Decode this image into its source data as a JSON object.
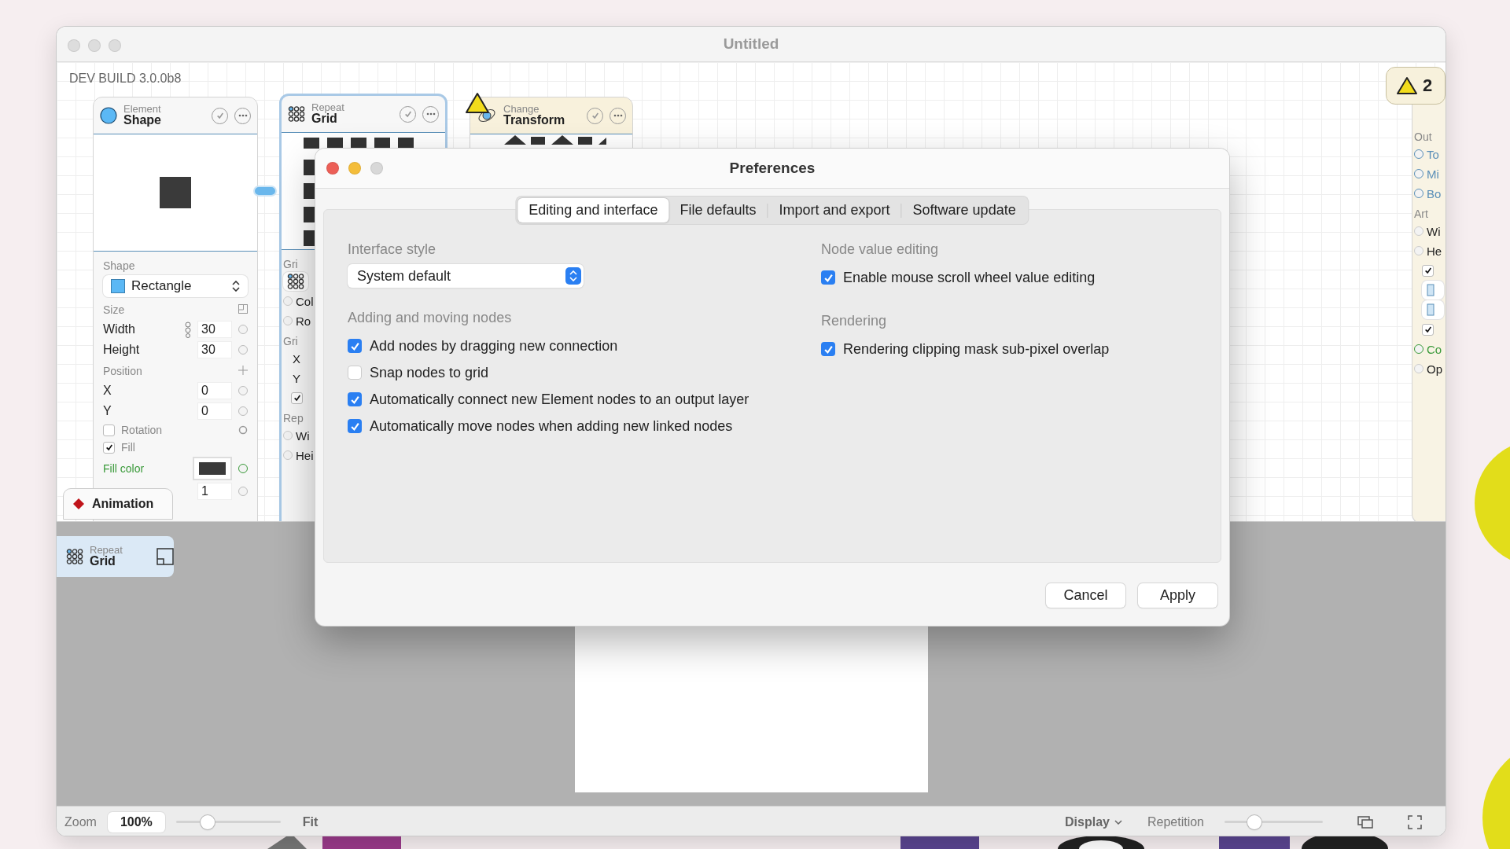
{
  "window": {
    "title": "Untitled"
  },
  "build_label": "DEV BUILD 3.0.0b8",
  "shape_node": {
    "category": "Element",
    "title": "Shape",
    "shape_label": "Shape",
    "shape_value": "Rectangle",
    "size_label": "Size",
    "size_fields": [
      {
        "label": "Width",
        "value": "30"
      },
      {
        "label": "Height",
        "value": "30"
      }
    ],
    "position_label": "Position",
    "position_fields": [
      {
        "label": "X",
        "value": "0"
      },
      {
        "label": "Y",
        "value": "0"
      }
    ],
    "toggles": [
      {
        "label": "Rotation",
        "checked": false
      },
      {
        "label": "Fill",
        "checked": true
      }
    ],
    "fill_color_label": "Fill color",
    "last_value": "1"
  },
  "animation_tab": {
    "label": "Animation"
  },
  "grid_node": {
    "category": "Repeat",
    "title": "Grid",
    "rows": [
      {
        "kind": "section",
        "text": "Gri"
      },
      {
        "kind": "select"
      },
      {
        "kind": "port",
        "text": "Col"
      },
      {
        "kind": "port",
        "text": "Ro"
      },
      {
        "kind": "section",
        "text": "Gri"
      },
      {
        "kind": "plain",
        "text": "X"
      },
      {
        "kind": "plain",
        "text": "Y"
      },
      {
        "kind": "check",
        "checked": true
      },
      {
        "kind": "section",
        "text": "Rep"
      },
      {
        "kind": "port",
        "text": "Wi"
      },
      {
        "kind": "port",
        "text": "Hei"
      }
    ]
  },
  "transform_node": {
    "category": "Change",
    "title": "Transform",
    "warning": true
  },
  "output_node": {
    "badge": "2",
    "rows": [
      {
        "kind": "section",
        "text": "Out"
      },
      {
        "kind": "link-port",
        "text": "To"
      },
      {
        "kind": "link-port",
        "text": "Mi"
      },
      {
        "kind": "link-port",
        "text": "Bo"
      },
      {
        "kind": "section",
        "text": "Art"
      },
      {
        "kind": "port",
        "text": "Wi"
      },
      {
        "kind": "port",
        "text": "He"
      },
      {
        "kind": "check",
        "checked": true
      },
      {
        "kind": "button"
      },
      {
        "kind": "button"
      },
      {
        "kind": "check",
        "checked": true
      },
      {
        "kind": "color-port",
        "text": "Co"
      },
      {
        "kind": "port",
        "text": "Op"
      }
    ]
  },
  "preview": {
    "chip": {
      "category": "Repeat",
      "title": "Grid"
    }
  },
  "bottom_bar": {
    "zoom_label": "Zoom",
    "zoom_value": "100%",
    "zoom_slider": {
      "level": 0.3
    },
    "fit": "Fit",
    "display": "Display",
    "repetition": "Repetition",
    "repetition_slider": {
      "level": 0.3
    }
  },
  "dialog": {
    "title": "Preferences",
    "tabs": [
      {
        "label": "Editing and interface",
        "selected": true
      },
      {
        "label": "File defaults",
        "selected": false
      },
      {
        "label": "Import and export",
        "selected": false
      },
      {
        "label": "Software update",
        "selected": false
      }
    ],
    "columns": [
      [
        {
          "heading": "Interface style",
          "kind": "select",
          "value": "System default"
        },
        {
          "heading": "Adding and moving nodes",
          "kind": "checks",
          "options": [
            {
              "label": "Add nodes by dragging new connection",
              "checked": true
            },
            {
              "label": "Snap nodes to grid",
              "checked": false
            },
            {
              "label": "Automatically connect new Element nodes to an output layer",
              "checked": true
            },
            {
              "label": "Automatically move nodes when adding new linked nodes",
              "checked": true
            }
          ]
        }
      ],
      [
        {
          "heading": "Node value editing",
          "kind": "checks",
          "options": [
            {
              "label": "Enable mouse scroll wheel value editing",
              "checked": true
            }
          ]
        },
        {
          "heading": "Rendering",
          "kind": "checks",
          "options": [
            {
              "label": "Rendering clipping mask sub-pixel overlap",
              "checked": true
            }
          ]
        }
      ]
    ],
    "buttons": [
      "Cancel",
      "Apply"
    ]
  }
}
